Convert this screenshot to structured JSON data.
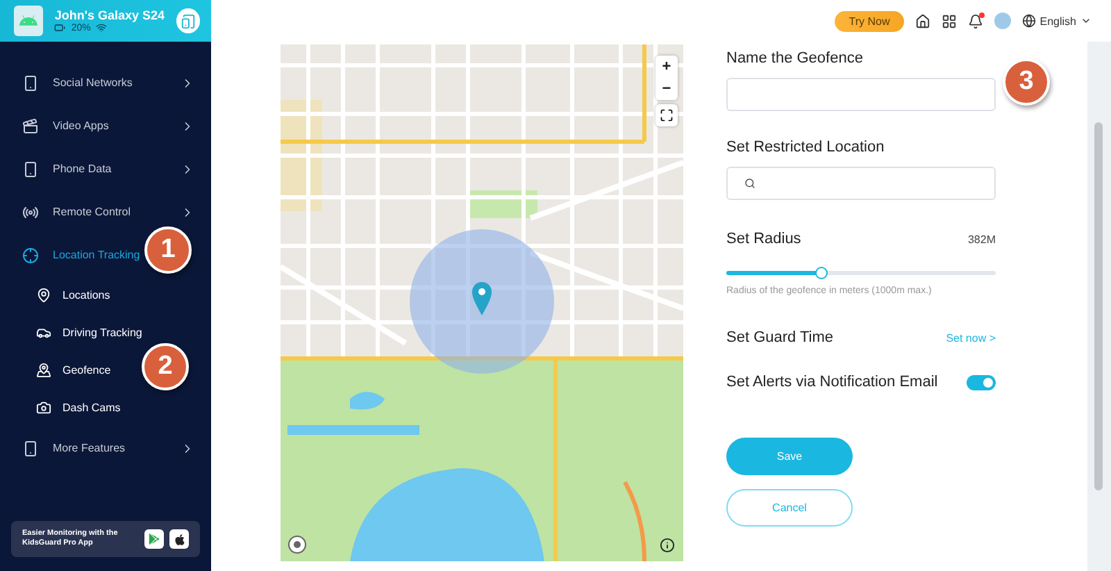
{
  "device": {
    "name": "John's Galaxy S24",
    "battery": "20%"
  },
  "sidebar": {
    "items": [
      {
        "label": "Social Networks",
        "kind": "phone",
        "selected": false,
        "expanded": false
      },
      {
        "label": "Video Apps",
        "kind": "video",
        "selected": false,
        "expanded": false
      },
      {
        "label": "Phone Data",
        "kind": "phone",
        "selected": false,
        "expanded": false
      },
      {
        "label": "Remote Control",
        "kind": "remote",
        "selected": false,
        "expanded": false
      },
      {
        "label": "Location Tracking",
        "kind": "location",
        "selected": true,
        "expanded": true,
        "children": [
          {
            "label": "Locations",
            "kind": "pin"
          },
          {
            "label": "Driving Tracking",
            "kind": "car"
          },
          {
            "label": "Geofence",
            "kind": "geofence"
          },
          {
            "label": "Dash Cams",
            "kind": "camera"
          }
        ]
      },
      {
        "label": "More Features",
        "kind": "phone",
        "selected": false,
        "expanded": false
      }
    ],
    "promo": "Easier Monitoring with the KidsGuard Pro App"
  },
  "topbar": {
    "try_now": "Try Now",
    "language": "English"
  },
  "map": {
    "zoom_in": "+",
    "zoom_out": "−"
  },
  "form": {
    "name_label": "Name the Geofence",
    "location_label": "Set Restricted Location",
    "radius_label": "Set Radius",
    "radius_value": "382M",
    "radius": {
      "level": 0.35
    },
    "radius_hint": "Radius of the geofence in meters (1000m max.)",
    "guard_label": "Set Guard Time",
    "guard_link": "Set now >",
    "alerts_label": "Set Alerts via Notification Email",
    "alerts_on": true,
    "save": "Save",
    "cancel": "Cancel"
  },
  "callouts": [
    {
      "label": "1"
    },
    {
      "label": "2"
    },
    {
      "label": "3"
    }
  ]
}
